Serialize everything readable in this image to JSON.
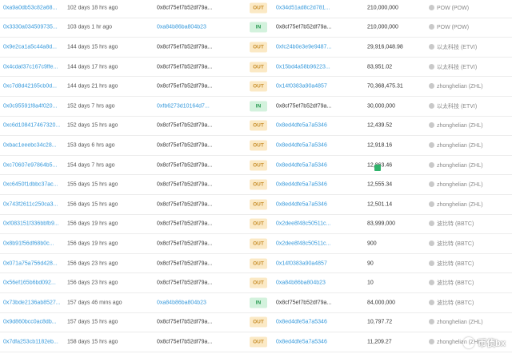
{
  "rows": [
    {
      "tx": "0xa9a0db53c82a68...",
      "age": "102 days 18 hrs ago",
      "from": "0x8cf75ef7b52df79a...",
      "dir": "OUT",
      "to": "0x34d51ad8c2d781...",
      "amount": "210,000,000",
      "token": "POW (POW)"
    },
    {
      "tx": "0x3330a034509735...",
      "age": "103 days 1 hr ago",
      "from": "0xa84b86ba804b23",
      "dir": "IN",
      "to": "0x8cf75ef7b52df79a...",
      "amount": "210,000,000",
      "token": "POW (POW)"
    },
    {
      "tx": "0x9e2ca1a5c44a8d...",
      "age": "144 days 15 hrs ago",
      "from": "0x8cf75ef7b52df79a...",
      "dir": "OUT",
      "to": "0xfc24b0e3e9e9487...",
      "amount": "29,916,048.98",
      "token": "以太科技 (ETVI)"
    },
    {
      "tx": "0x4cdaf37c167c9ffe...",
      "age": "144 days 17 hrs ago",
      "from": "0x8cf75ef7b52df79a...",
      "dir": "OUT",
      "to": "0x15bd4a58b96223...",
      "amount": "83,951.02",
      "token": "以太科技 (ETVI)"
    },
    {
      "tx": "0xc7d8d42165cb0d...",
      "age": "144 days 21 hrs ago",
      "from": "0x8cf75ef7b52df79a...",
      "dir": "OUT",
      "to": "0x14f0383a90a4857",
      "amount": "70,368,475.31",
      "token": "zhonghelian (ZHL)"
    },
    {
      "tx": "0x0c95591f8a4f020...",
      "age": "152 days 7 hrs ago",
      "from": "0xfb6273d10164d7...",
      "dir": "IN",
      "to": "0x8cf75ef7b52df79a...",
      "amount": "30,000,000",
      "token": "以太科技 (ETVI)"
    },
    {
      "tx": "0xc6d108417467320...",
      "age": "152 days 15 hrs ago",
      "from": "0x8cf75ef7b52df79a...",
      "dir": "OUT",
      "to": "0x8ed4dfe5a7a5346",
      "amount": "12,439.52",
      "token": "zhonghelian (ZHL)"
    },
    {
      "tx": "0xbac1eeebc34c28...",
      "age": "153 days 6 hrs ago",
      "from": "0x8cf75ef7b52df79a...",
      "dir": "OUT",
      "to": "0x8ed4dfe5a7a5346",
      "amount": "12,918.16",
      "token": "zhonghelian (ZHL)"
    },
    {
      "tx": "0xc70607e97864b5...",
      "age": "154 days 7 hrs ago",
      "from": "0x8cf75ef7b52df79a...",
      "dir": "OUT",
      "to": "0x8ed4dfe5a7a5346",
      "amount": "12,863.46",
      "token": "zhonghelian (ZHL)"
    },
    {
      "tx": "0xc6450f1dbbc37ac...",
      "age": "155 days 15 hrs ago",
      "from": "0x8cf75ef7b52df79a...",
      "dir": "OUT",
      "to": "0x8ed4dfe5a7a5346",
      "amount": "12,555.34",
      "token": "zhonghelian (ZHL)"
    },
    {
      "tx": "0x743f2611c250ca3...",
      "age": "156 days 15 hrs ago",
      "from": "0x8cf75ef7b52df79a...",
      "dir": "OUT",
      "to": "0x8ed4dfe5a7a5346",
      "amount": "12,501.14",
      "token": "zhonghelian (ZHL)"
    },
    {
      "tx": "0xf083151f336bbfb9...",
      "age": "156 days 19 hrs ago",
      "from": "0x8cf75ef7b52df79a...",
      "dir": "OUT",
      "to": "0x2dee8f48c50511c...",
      "amount": "83,999,000",
      "token": "波比特 (BBTC)"
    },
    {
      "tx": "0x8b91f56df68b0c...",
      "age": "156 days 19 hrs ago",
      "from": "0x8cf75ef7b52df79a...",
      "dir": "OUT",
      "to": "0x2dee8f48c50511c...",
      "amount": "900",
      "token": "波比特 (BBTC)"
    },
    {
      "tx": "0x071a75a756d428...",
      "age": "156 days 23 hrs ago",
      "from": "0x8cf75ef7b52df79a...",
      "dir": "OUT",
      "to": "0x14f0383a90a4857",
      "amount": "90",
      "token": "波比特 (BBTC)"
    },
    {
      "tx": "0x56ef165b6bd092...",
      "age": "156 days 23 hrs ago",
      "from": "0x8cf75ef7b52df79a...",
      "dir": "OUT",
      "to": "0xa84b86ba804b23",
      "amount": "10",
      "token": "波比特 (BBTC)"
    },
    {
      "tx": "0x73bde2136ab8527...",
      "age": "157 days 46 mins ago",
      "from": "0xa84b86ba804b23",
      "dir": "IN",
      "to": "0x8cf75ef7b52df79a...",
      "amount": "84,000,000",
      "token": "波比特 (BBTC)"
    },
    {
      "tx": "0x9d860bcc0ac8db...",
      "age": "157 days 15 hrs ago",
      "from": "0x8cf75ef7b52df79a...",
      "dir": "OUT",
      "to": "0x8ed4dfe5a7a5346",
      "amount": "10,797.72",
      "token": "zhonghelian (ZHL)"
    },
    {
      "tx": "0x7dfa253cb1182eb...",
      "age": "158 days 15 hrs ago",
      "from": "0x8cf75ef7b52df79a...",
      "dir": "OUT",
      "to": "0x8ed4dfe5a7a5346",
      "amount": "11,209.27",
      "token": "zhonghelian (ZHL)"
    }
  ],
  "watermark": {
    "text": "币侦bx"
  },
  "colors": {
    "link": "#3498db",
    "out_bg": "#fbe9c5",
    "in_bg": "#d3f2dd"
  }
}
